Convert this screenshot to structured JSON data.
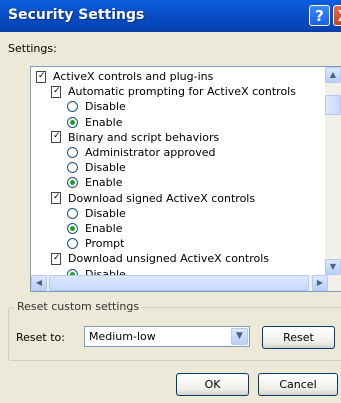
{
  "window": {
    "title": "Security Settings",
    "help_glyph": "?",
    "close_glyph": "X"
  },
  "settings_label": "Settings:",
  "tree": {
    "items": [
      {
        "kind": "folder",
        "label": "ActiveX controls and plug-ins",
        "level": 0
      },
      {
        "kind": "folder",
        "label": "Automatic prompting for ActiveX controls",
        "level": 1
      },
      {
        "kind": "radio",
        "label": "Disable",
        "level": 2,
        "selected": false
      },
      {
        "kind": "radio",
        "label": "Enable",
        "level": 2,
        "selected": true
      },
      {
        "kind": "folder",
        "label": "Binary and script behaviors",
        "level": 1
      },
      {
        "kind": "radio",
        "label": "Administrator approved",
        "level": 2,
        "selected": false
      },
      {
        "kind": "radio",
        "label": "Disable",
        "level": 2,
        "selected": false
      },
      {
        "kind": "radio",
        "label": "Enable",
        "level": 2,
        "selected": true
      },
      {
        "kind": "folder",
        "label": "Download signed ActiveX controls",
        "level": 1
      },
      {
        "kind": "radio",
        "label": "Disable",
        "level": 2,
        "selected": false
      },
      {
        "kind": "radio",
        "label": "Enable",
        "level": 2,
        "selected": true
      },
      {
        "kind": "radio",
        "label": "Prompt",
        "level": 2,
        "selected": false
      },
      {
        "kind": "folder",
        "label": "Download unsigned ActiveX controls",
        "level": 1
      },
      {
        "kind": "radio",
        "label": "Disable",
        "level": 2,
        "selected": true
      }
    ]
  },
  "reset_group": {
    "legend": "Reset custom settings",
    "reset_to_label": "Reset to:",
    "selected_value": "Medium-low",
    "reset_label": "Reset"
  },
  "footer": {
    "ok_label": "OK",
    "cancel_label": "Cancel"
  }
}
